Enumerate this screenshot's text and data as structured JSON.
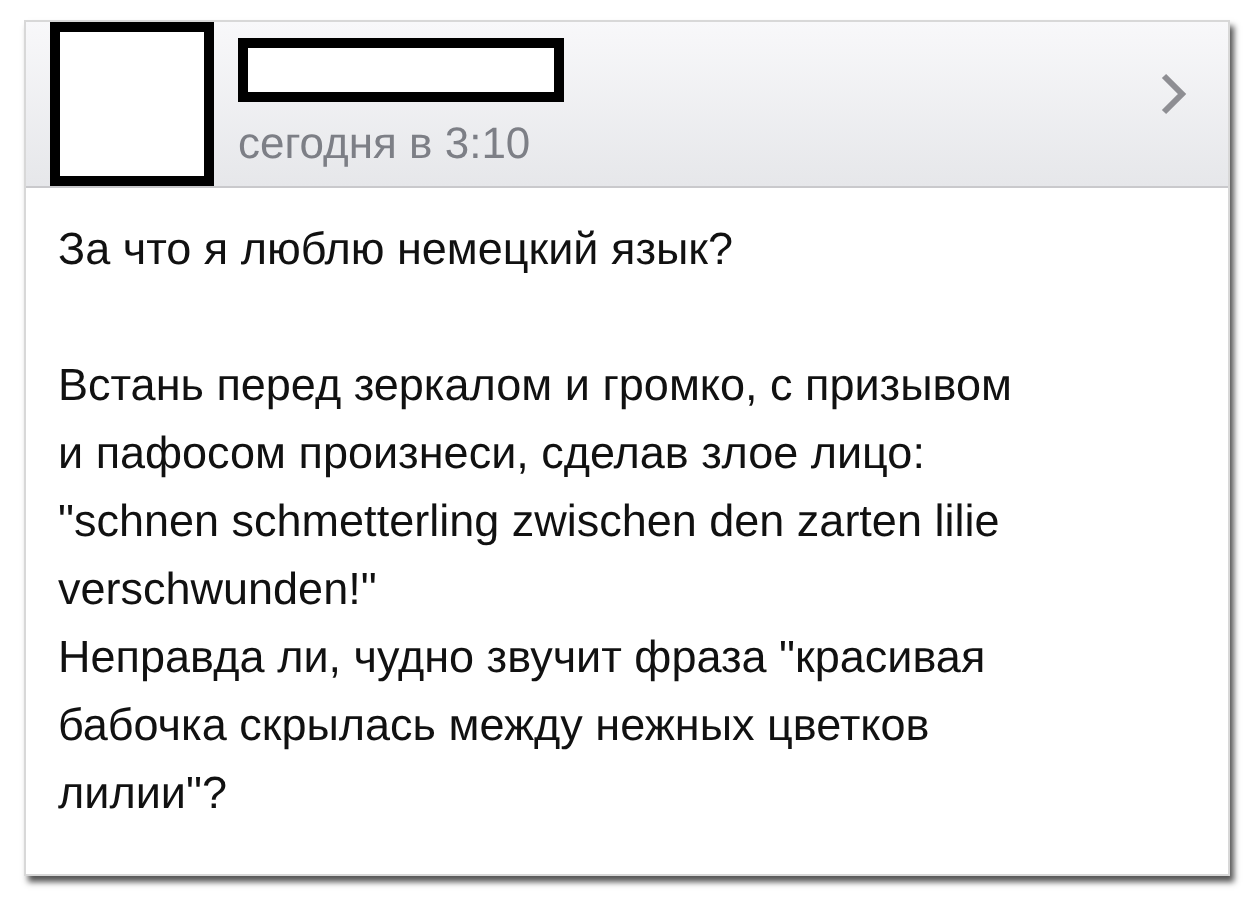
{
  "post": {
    "time": "сегодня в 3:10",
    "paragraphs": [
      "За что я люблю немецкий язык?",
      "Встань перед зеркалом и громко, с призывом\nи пафосом произнеси, сделав злое лицо:\n\"schnen schmetterling zwischen den zarten lilie\nverschwunden!\"\nНеправда ли, чудно звучит фраза \"красивая\nбабочка скрылась между нежных цветков\nлилии\"?"
    ]
  }
}
